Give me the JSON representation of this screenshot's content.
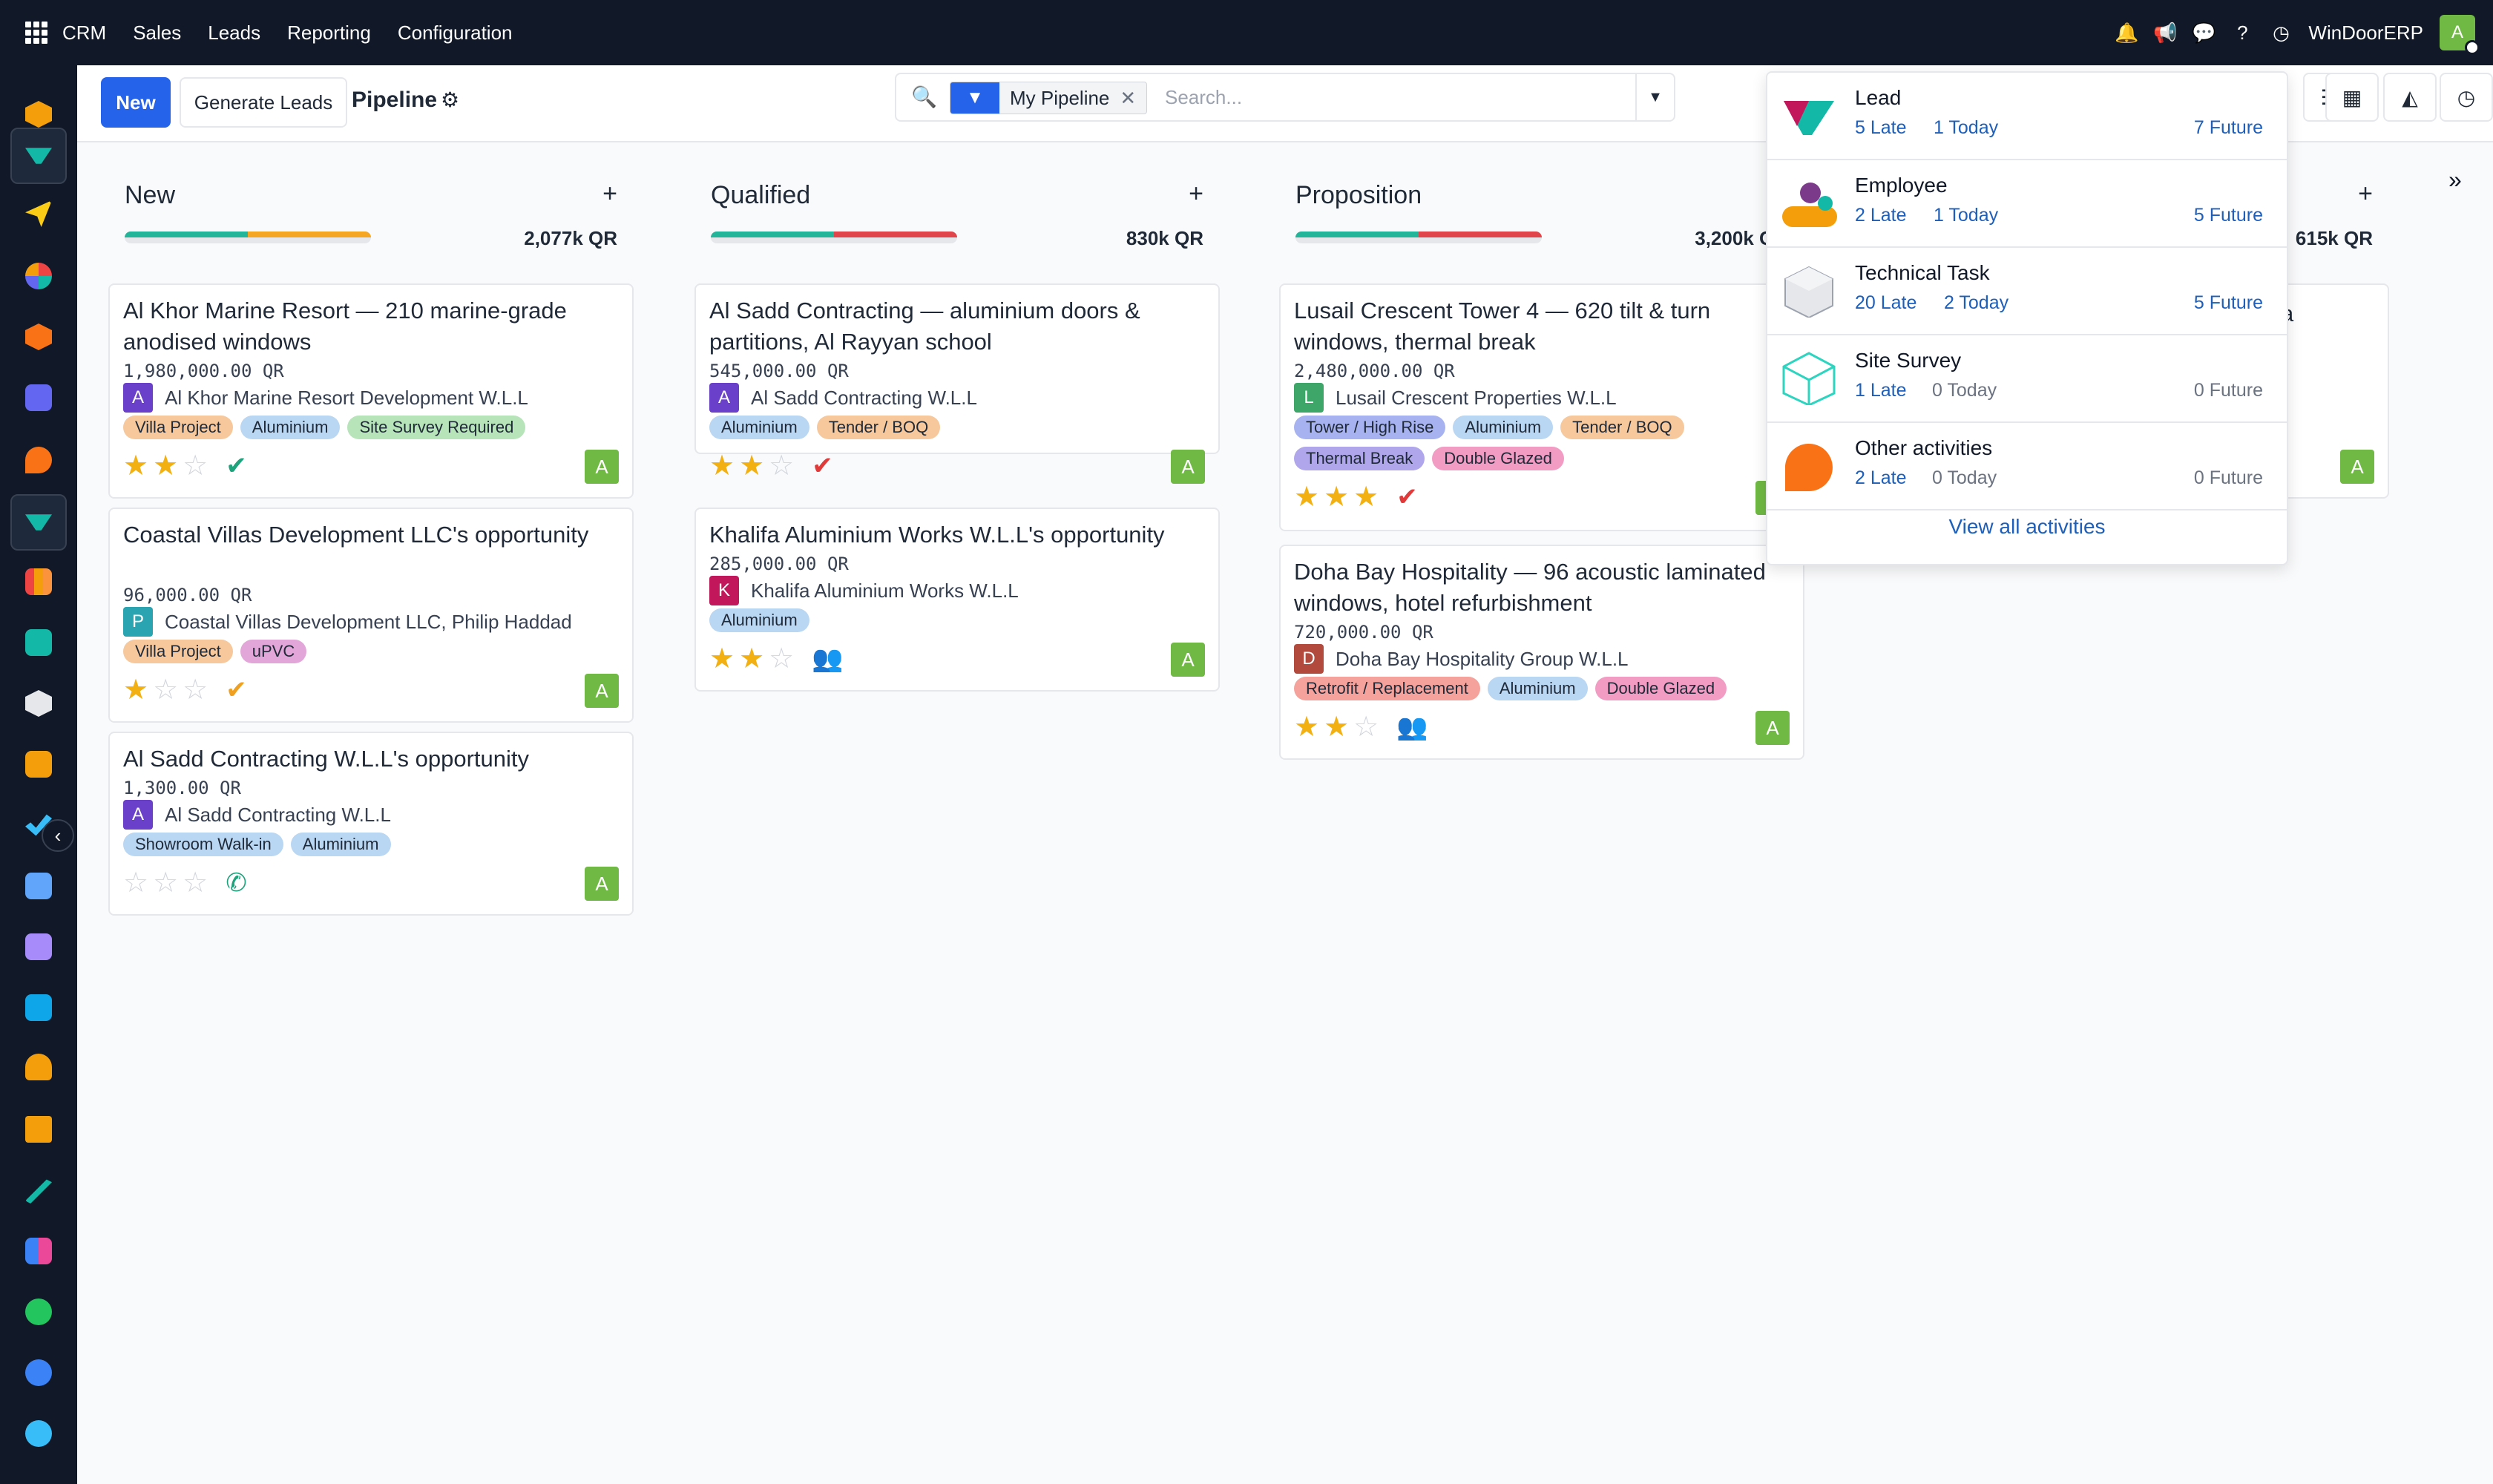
{
  "topbar": {
    "app": "CRM",
    "menu": [
      "Sales",
      "Leads",
      "Reporting",
      "Configuration"
    ],
    "company": "WinDoorERP",
    "avatar": "A"
  },
  "control": {
    "new_label": "New",
    "generate_label": "Generate Leads",
    "title": "Pipeline",
    "facet": "My Pipeline",
    "search_placeholder": "Search..."
  },
  "columns": [
    {
      "name": "New",
      "total": "2,077k QR",
      "cards": [
        {
          "title": "Al Khor Marine Resort — 210 marine-grade anodised windows",
          "amount": "1,980,000.00 QR",
          "avatar": "A",
          "customer": "Al Khor Marine Resort Development W.L.L",
          "tags": [
            "Villa Project",
            "Aluminium",
            "Site Survey Required"
          ],
          "stars": 2,
          "activity": "check-green",
          "owner": "A"
        },
        {
          "title": "Coastal Villas Development LLC's opportunity",
          "amount": "96,000.00 QR",
          "avatar": "P",
          "customer": "Coastal Villas Development LLC, Philip Haddad",
          "tags": [
            "Villa Project",
            "uPVC"
          ],
          "stars": 1,
          "activity": "check-orange",
          "owner": "A"
        },
        {
          "title": "Al Sadd Contracting W.L.L's opportunity",
          "amount": "1,300.00 QR",
          "avatar": "A",
          "customer": "Al Sadd Contracting W.L.L",
          "tags": [
            "Showroom Walk-in",
            "Aluminium"
          ],
          "stars": 0,
          "activity": "phone",
          "owner": "A"
        }
      ]
    },
    {
      "name": "Qualified",
      "total": "830k QR",
      "cards": [
        {
          "title": "Al Sadd Contracting — aluminium doors & partitions, Al Rayyan school",
          "amount": "545,000.00 QR",
          "avatar": "A",
          "customer": "Al Sadd Contracting W.L.L",
          "tags": [
            "Aluminium",
            "Tender / BOQ"
          ],
          "stars": 2,
          "activity": "check-red",
          "owner": "A"
        },
        {
          "title": "Khalifa Aluminium Works W.L.L's opportunity",
          "amount": "285,000.00 QR",
          "avatar": "K",
          "customer": "Khalifa Aluminium Works W.L.L",
          "tags": [
            "Aluminium"
          ],
          "stars": 2,
          "activity": "users",
          "owner": "A"
        }
      ]
    },
    {
      "name": "Proposition",
      "total": "3,200k QR",
      "cards": [
        {
          "title": "Lusail Crescent Tower 4 — 620 tilt & turn windows, thermal break",
          "amount": "2,480,000.00 QR",
          "avatar": "L",
          "customer": "Lusail Crescent Properties W.L.L",
          "tags": [
            "Tower / High Rise",
            "Aluminium",
            "Tender / BOQ",
            "Thermal Break",
            "Double Glazed"
          ],
          "stars": 3,
          "activity": "check-red",
          "owner": "A"
        },
        {
          "title": "Doha Bay Hospitality — 96 acoustic laminated windows, hotel refurbishment",
          "amount": "720,000.00 QR",
          "avatar": "D",
          "customer": "Doha Bay Hospitality Group W.L.L",
          "tags": [
            "Retrofit / Replacement",
            "Aluminium",
            "Double Glazed"
          ],
          "stars": 2,
          "activity": "users",
          "owner": "A"
        }
      ]
    },
    {
      "name": "",
      "total": "615k QR",
      "cards": [
        {
          "title": "a",
          "owner": "A"
        }
      ]
    }
  ],
  "activities": [
    {
      "name": "Lead",
      "late": "5 Late",
      "today": "1 Today",
      "future": "7 Future"
    },
    {
      "name": "Employee",
      "late": "2 Late",
      "today": "1 Today",
      "future": "5 Future"
    },
    {
      "name": "Technical Task",
      "late": "20 Late",
      "today": "2 Today",
      "future": "5 Future"
    },
    {
      "name": "Site Survey",
      "late": "1 Late",
      "today": "0 Today",
      "future": "0 Future"
    },
    {
      "name": "Other activities",
      "late": "2 Late",
      "today": "0 Today",
      "future": "0 Future"
    }
  ],
  "activities_view_all": "View all activities",
  "colors": {
    "accent": "#2563eb",
    "topbar": "#111827",
    "owner": "#70b944",
    "link": "#1d5fba"
  },
  "tag_colors": {
    "Villa Project": "#f6c89c",
    "Aluminium": "#b9d6f2",
    "Site Survey Required": "#b7e4b9",
    "uPVC": "#e2a6d8",
    "Showroom Walk-in": "#b9d6f2",
    "Tender / BOQ": "#f6c89c",
    "Tower / High Rise": "#a7b3f0",
    "Thermal Break": "#b0a6ec",
    "Double Glazed": "#f29cc4",
    "Retrofit / Replacement": "#f4a29b"
  },
  "avatar_colors": {
    "A": "#6a3fc9",
    "P": "#2aa4b0",
    "K": "#c2185b",
    "L": "#3fa66a",
    "D": "#b24a3e"
  }
}
